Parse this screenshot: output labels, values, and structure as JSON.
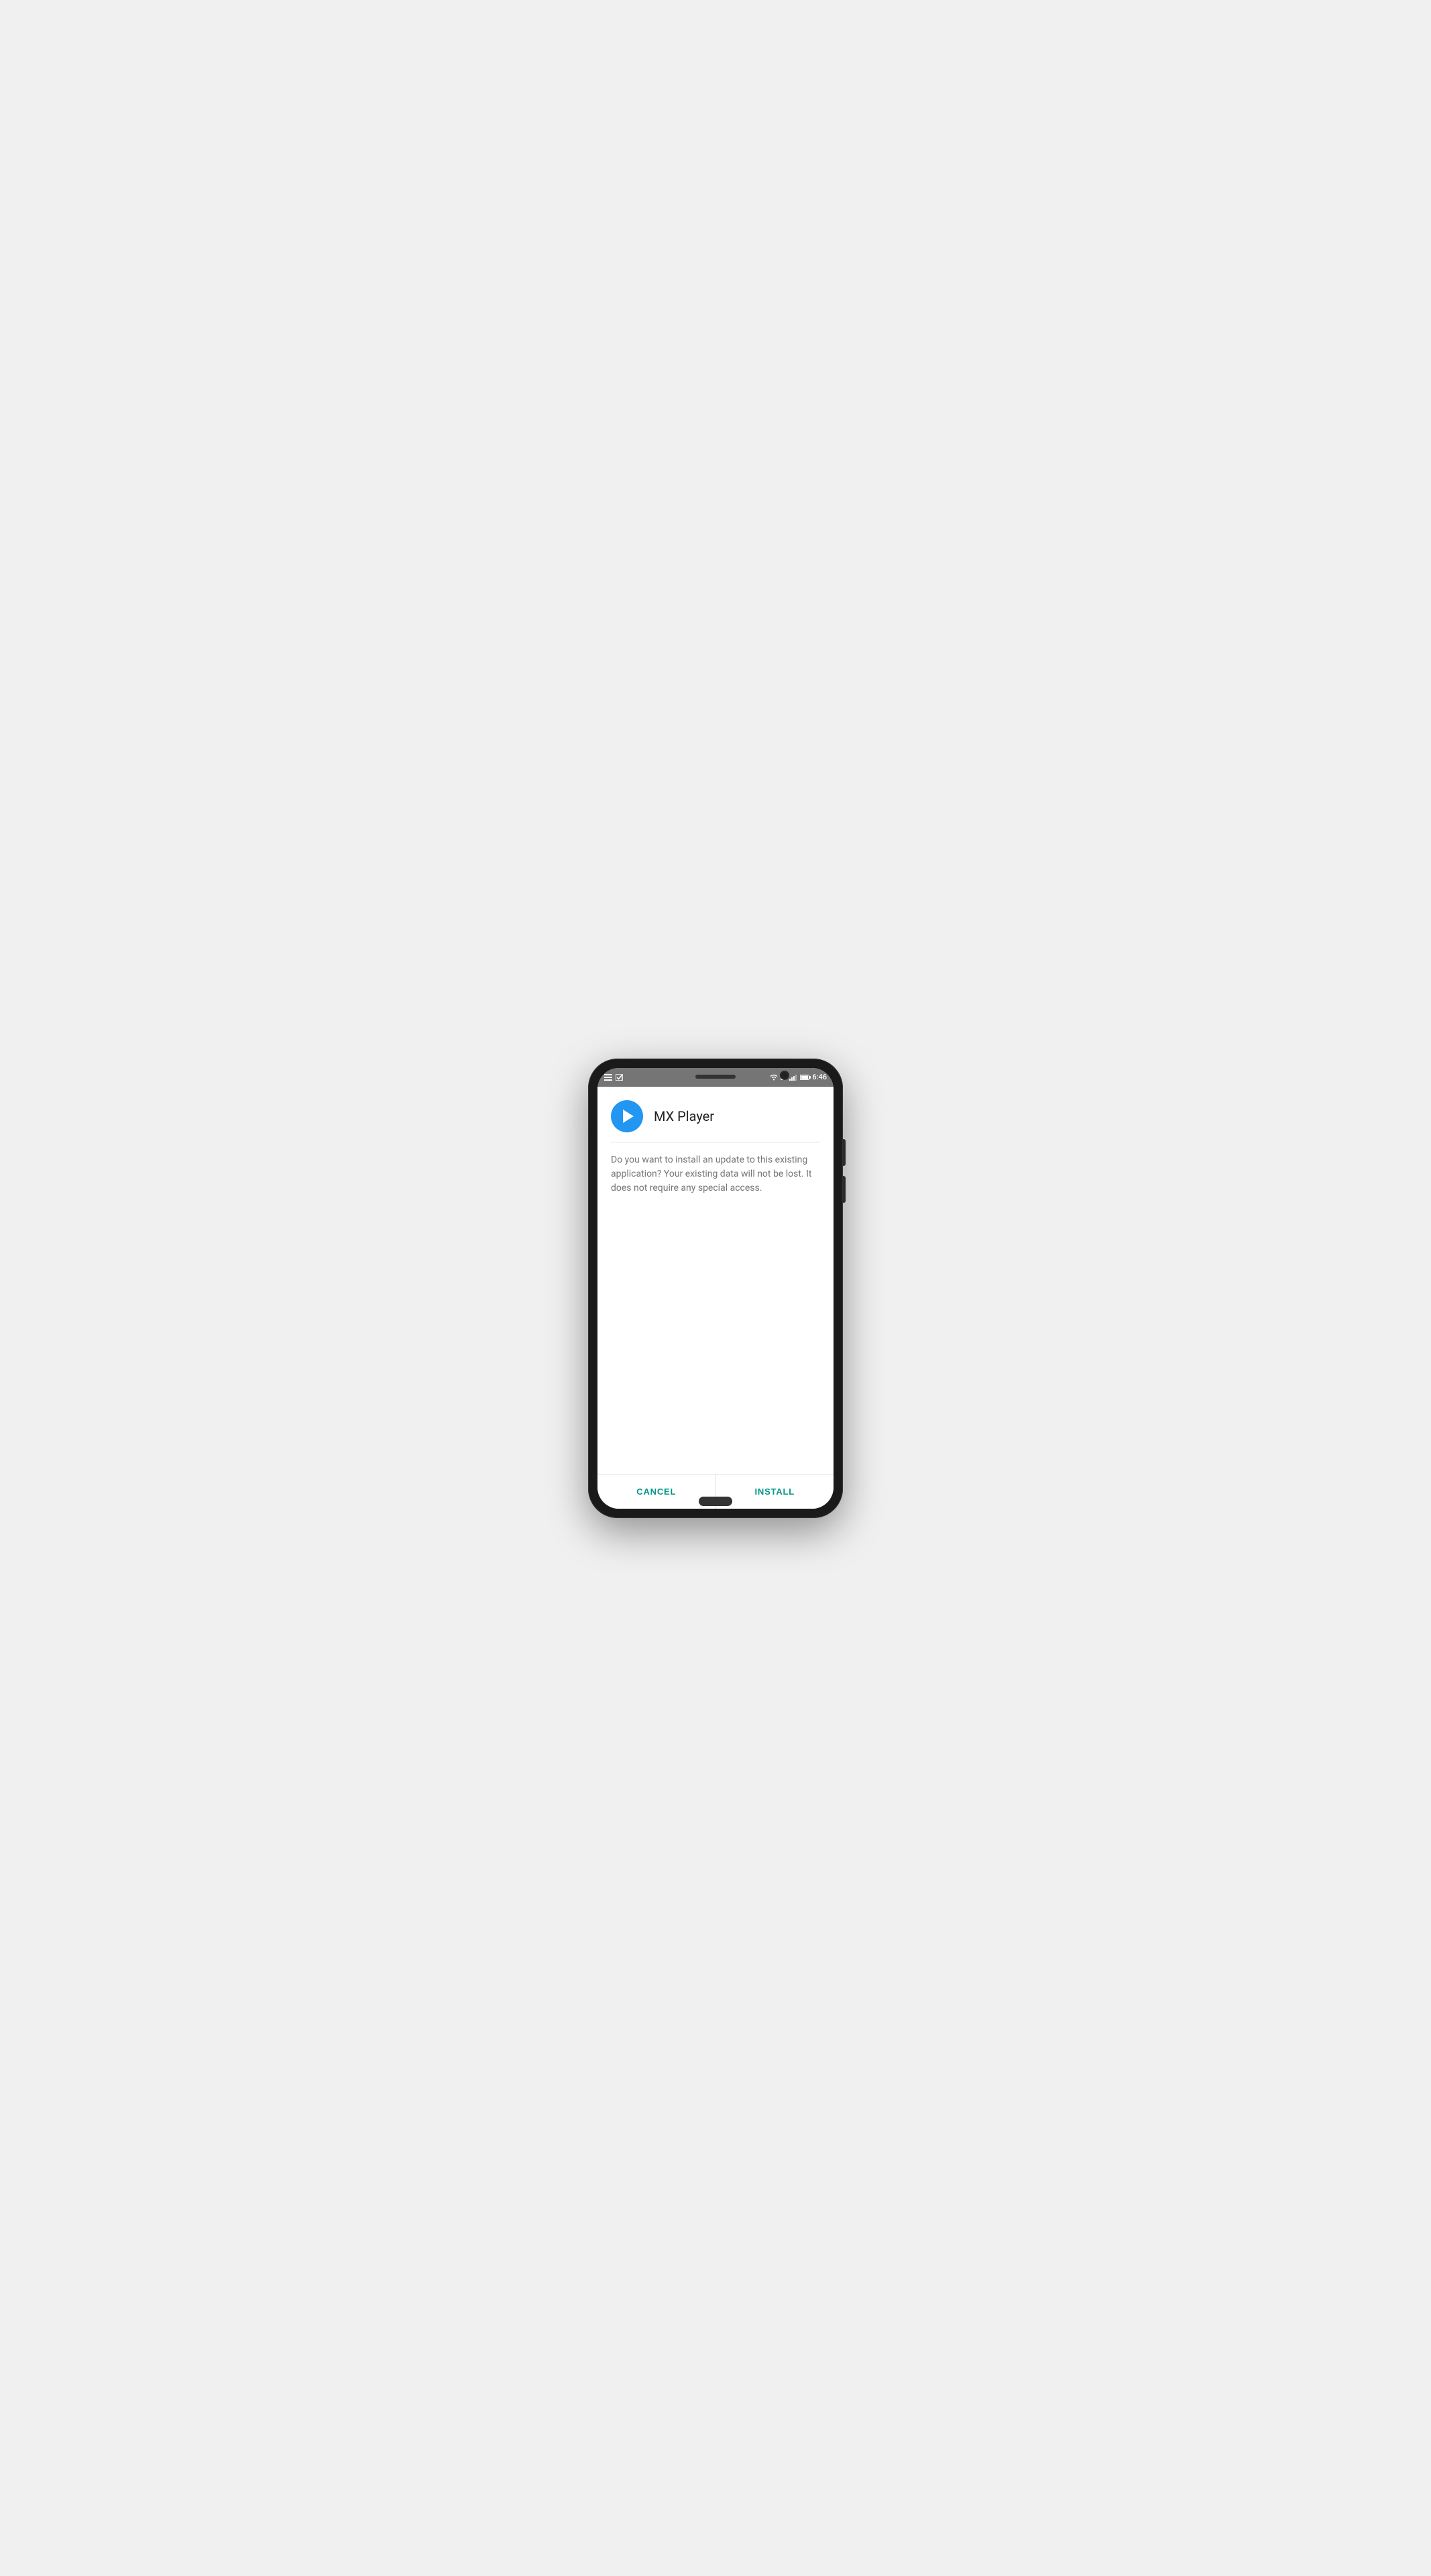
{
  "device": {
    "status_bar": {
      "time": "6:46",
      "wifi_icon": "wifi",
      "h_badge": "H",
      "signal_icon": "signal",
      "battery_icon": "battery"
    }
  },
  "dialog": {
    "app_icon_type": "play",
    "app_name": "MX Player",
    "message": "Do you want to install an update to this existing application? Your existing data will not be lost. It does not require any special access.",
    "cancel_label": "CANCEL",
    "install_label": "INSTALL"
  }
}
